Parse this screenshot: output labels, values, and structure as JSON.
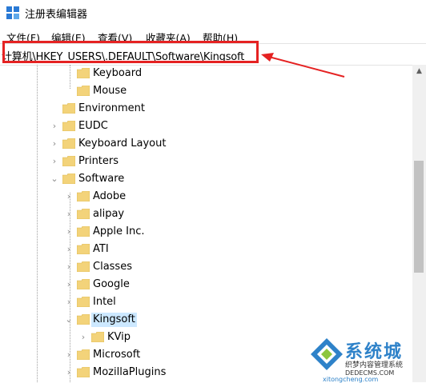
{
  "window": {
    "title": "注册表编辑器"
  },
  "menu": [
    "文件(F)",
    "编辑(E)",
    "查看(V)",
    "收藏夹(A)",
    "帮助(H)"
  ],
  "address_bar": {
    "path": "计算机\\HKEY_USERS\\.DEFAULT\\Software\\Kingsoft"
  },
  "tree": [
    {
      "label": "Keyboard",
      "expander": ""
    },
    {
      "label": "Mouse",
      "expander": ""
    },
    {
      "label": "Environment",
      "expander": ""
    },
    {
      "label": "EUDC",
      "expander": ">"
    },
    {
      "label": "Keyboard Layout",
      "expander": ">"
    },
    {
      "label": "Printers",
      "expander": ">"
    },
    {
      "label": "Software",
      "expander": "v"
    },
    {
      "label": "Adobe",
      "expander": ">"
    },
    {
      "label": "alipay",
      "expander": ">"
    },
    {
      "label": "Apple Inc.",
      "expander": ">"
    },
    {
      "label": "ATI",
      "expander": ">"
    },
    {
      "label": "Classes",
      "expander": ">"
    },
    {
      "label": "Google",
      "expander": ">"
    },
    {
      "label": "Intel",
      "expander": ">"
    },
    {
      "label": "Kingsoft",
      "expander": "v",
      "selected": true
    },
    {
      "label": "KVip",
      "expander": ">"
    },
    {
      "label": "Microsoft",
      "expander": ">"
    },
    {
      "label": "MozillaPlugins",
      "expander": ">"
    }
  ],
  "watermark": {
    "text": "系统城",
    "subtitle": "织梦内容管理系统",
    "url": "DEDECMS.COM",
    "site": "xitongcheng.com"
  },
  "colors": {
    "highlight": "#e52222",
    "folder": "#f3d37a",
    "selected": "#cce8ff"
  }
}
